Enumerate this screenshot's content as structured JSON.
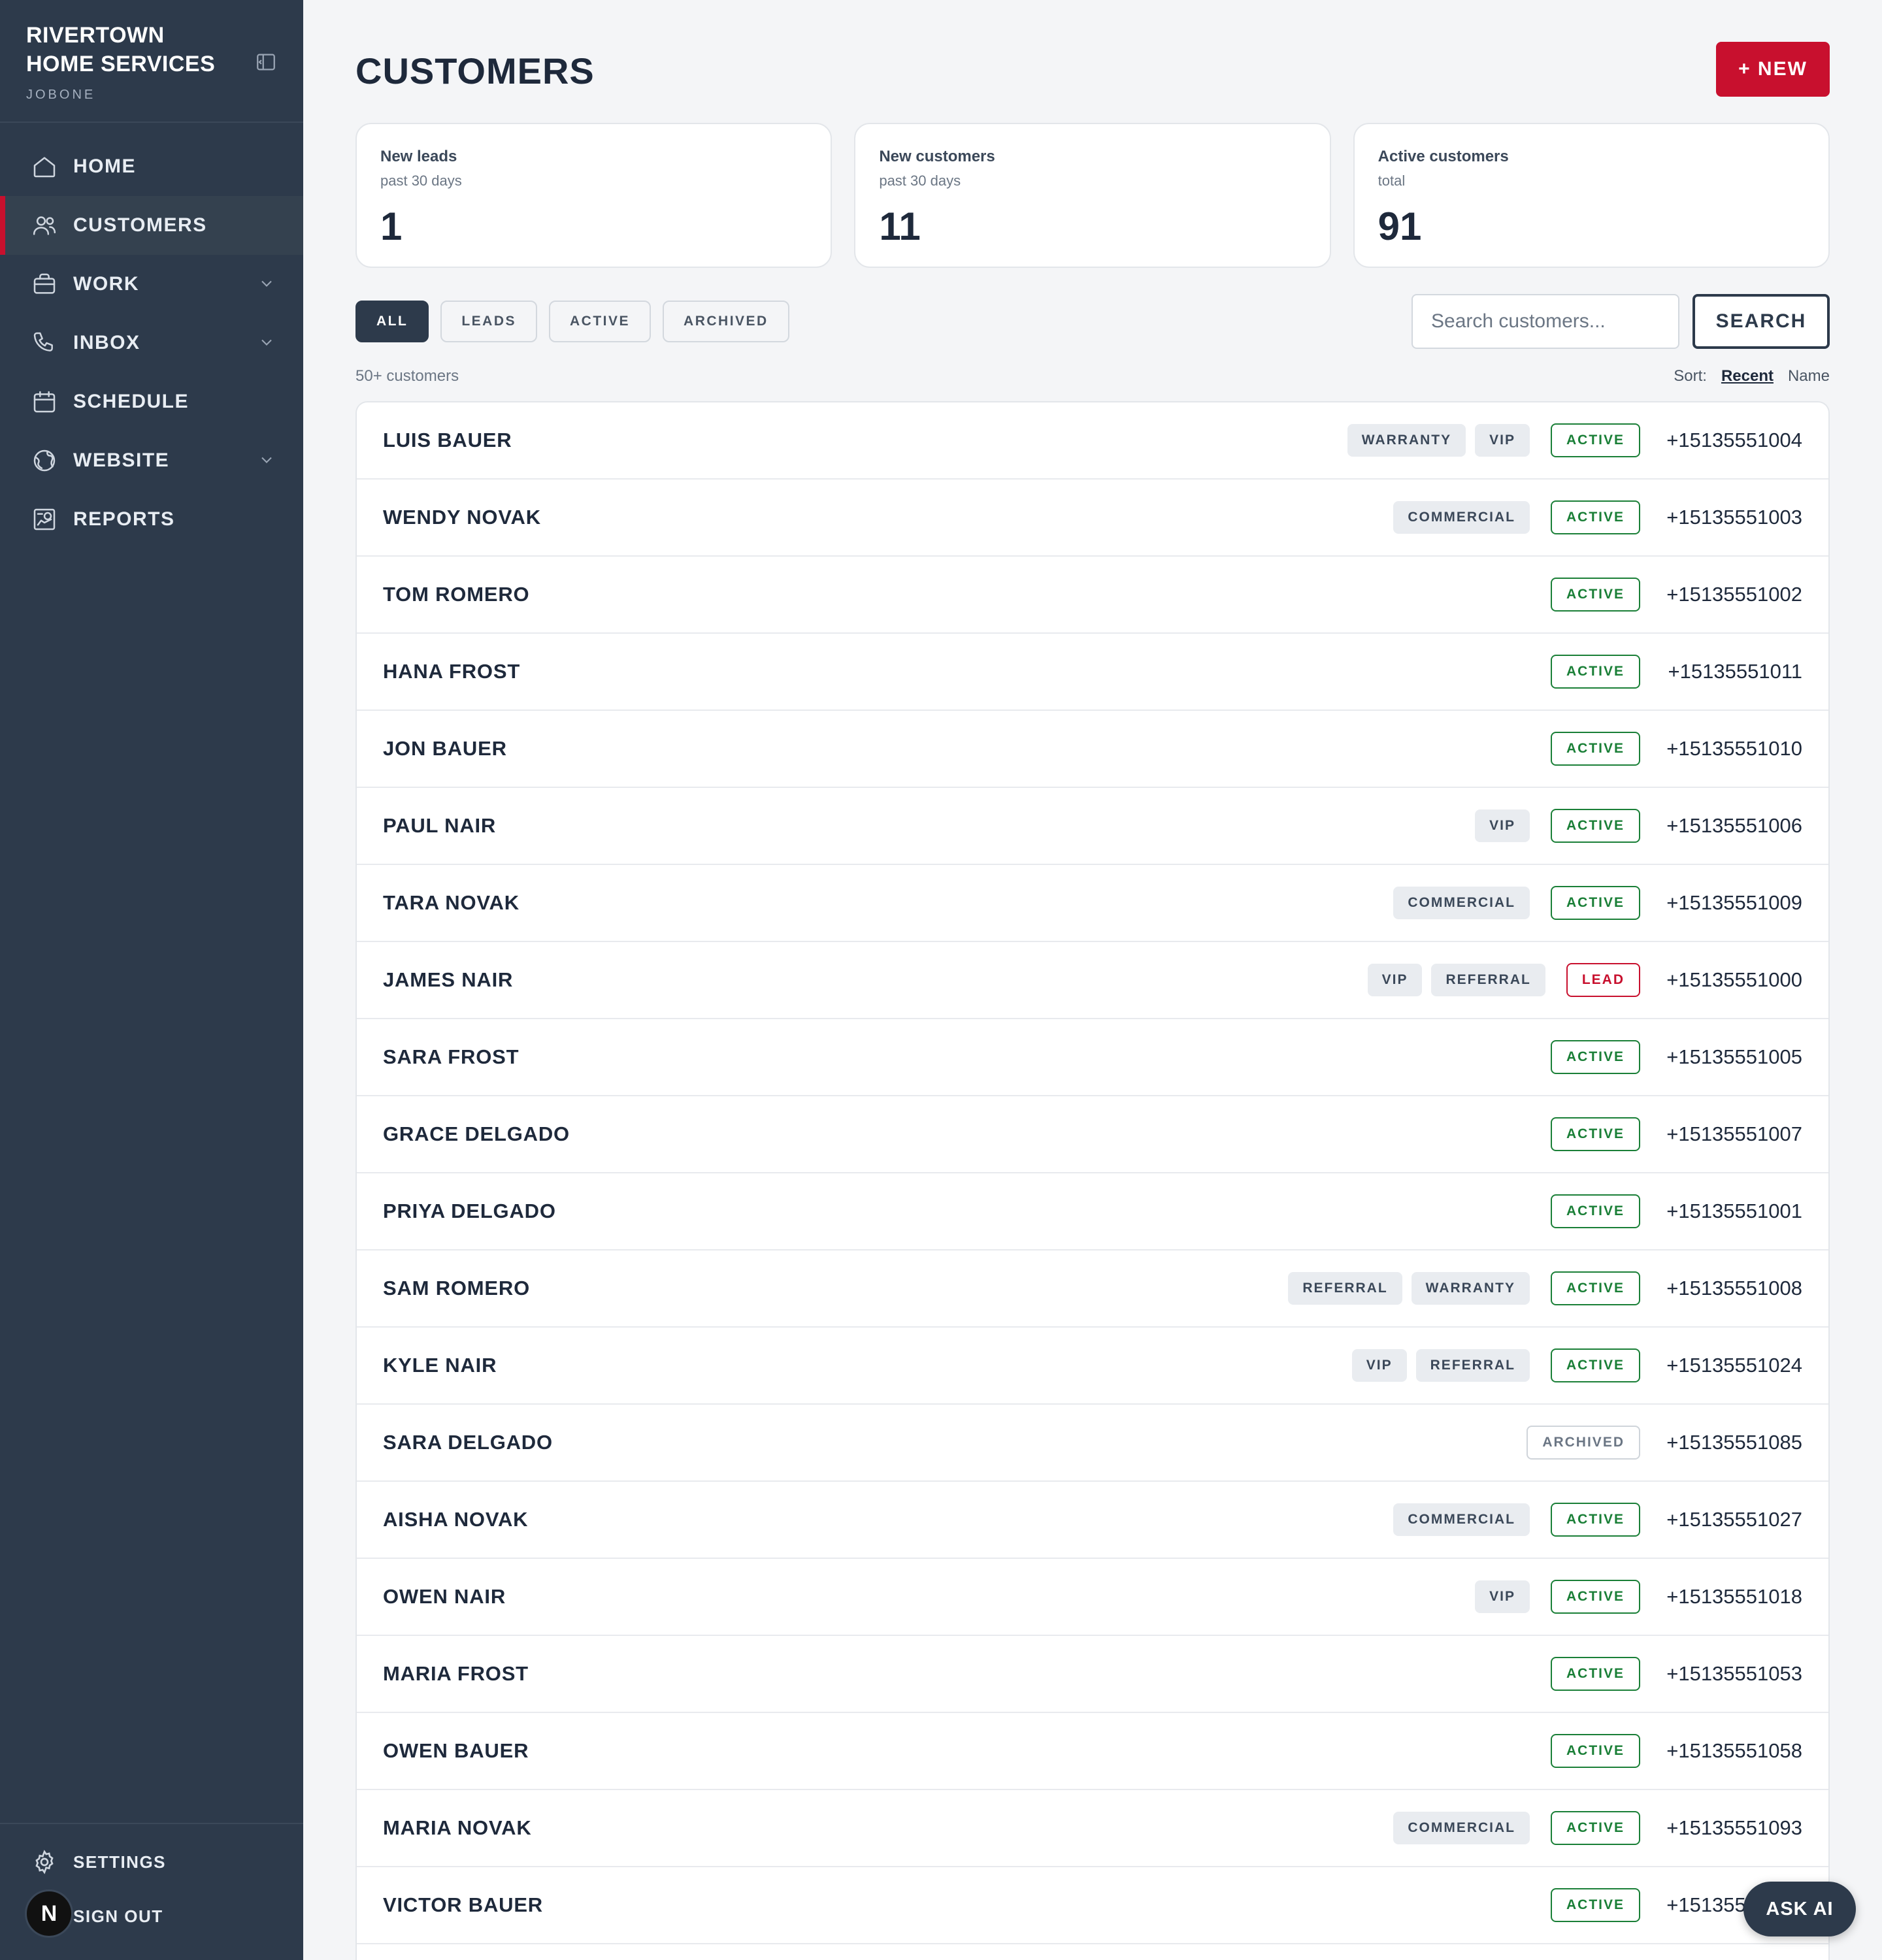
{
  "brand": {
    "title": "RIVERTOWN HOME SERVICES",
    "subtitle": "JOBONE"
  },
  "nav": [
    {
      "label": "HOME",
      "icon": "home-icon",
      "active": false,
      "expandable": false
    },
    {
      "label": "CUSTOMERS",
      "icon": "users-icon",
      "active": true,
      "expandable": false
    },
    {
      "label": "WORK",
      "icon": "briefcase-icon",
      "active": false,
      "expandable": true
    },
    {
      "label": "INBOX",
      "icon": "phone-icon",
      "active": false,
      "expandable": true
    },
    {
      "label": "SCHEDULE",
      "icon": "calendar-icon",
      "active": false,
      "expandable": false
    },
    {
      "label": "WEBSITE",
      "icon": "globe-icon",
      "active": false,
      "expandable": true
    },
    {
      "label": "REPORTS",
      "icon": "report-icon",
      "active": false,
      "expandable": false
    }
  ],
  "sidebar_bottom": {
    "settings": "SETTINGS",
    "signout": "SIGN OUT",
    "avatar_letter": "N"
  },
  "page": {
    "title": "CUSTOMERS",
    "new_button": "+ NEW"
  },
  "stats": [
    {
      "label": "New leads",
      "sub": "past 30 days",
      "value": "1"
    },
    {
      "label": "New customers",
      "sub": "past 30 days",
      "value": "11"
    },
    {
      "label": "Active customers",
      "sub": "total",
      "value": "91"
    }
  ],
  "filters": [
    "ALL",
    "LEADS",
    "ACTIVE",
    "ARCHIVED"
  ],
  "active_filter": "ALL",
  "search": {
    "placeholder": "Search customers...",
    "button": "SEARCH"
  },
  "count_text": "50+ customers",
  "sort": {
    "label": "Sort:",
    "options": [
      "Recent",
      "Name"
    ],
    "current": "Recent"
  },
  "customers": [
    {
      "name": "LUIS BAUER",
      "tags": [
        "WARRANTY",
        "VIP"
      ],
      "status": "ACTIVE",
      "phone": "+15135551004"
    },
    {
      "name": "WENDY NOVAK",
      "tags": [
        "COMMERCIAL"
      ],
      "status": "ACTIVE",
      "phone": "+15135551003"
    },
    {
      "name": "TOM ROMERO",
      "tags": [],
      "status": "ACTIVE",
      "phone": "+15135551002"
    },
    {
      "name": "HANA FROST",
      "tags": [],
      "status": "ACTIVE",
      "phone": "+15135551011"
    },
    {
      "name": "JON BAUER",
      "tags": [],
      "status": "ACTIVE",
      "phone": "+15135551010"
    },
    {
      "name": "PAUL NAIR",
      "tags": [
        "VIP"
      ],
      "status": "ACTIVE",
      "phone": "+15135551006"
    },
    {
      "name": "TARA NOVAK",
      "tags": [
        "COMMERCIAL"
      ],
      "status": "ACTIVE",
      "phone": "+15135551009"
    },
    {
      "name": "JAMES NAIR",
      "tags": [
        "VIP",
        "REFERRAL"
      ],
      "status": "LEAD",
      "phone": "+15135551000"
    },
    {
      "name": "SARA FROST",
      "tags": [],
      "status": "ACTIVE",
      "phone": "+15135551005"
    },
    {
      "name": "GRACE DELGADO",
      "tags": [],
      "status": "ACTIVE",
      "phone": "+15135551007"
    },
    {
      "name": "PRIYA DELGADO",
      "tags": [],
      "status": "ACTIVE",
      "phone": "+15135551001"
    },
    {
      "name": "SAM ROMERO",
      "tags": [
        "REFERRAL",
        "WARRANTY"
      ],
      "status": "ACTIVE",
      "phone": "+15135551008"
    },
    {
      "name": "KYLE NAIR",
      "tags": [
        "VIP",
        "REFERRAL"
      ],
      "status": "ACTIVE",
      "phone": "+15135551024"
    },
    {
      "name": "SARA DELGADO",
      "tags": [],
      "status": "ARCHIVED",
      "phone": "+15135551085"
    },
    {
      "name": "AISHA NOVAK",
      "tags": [
        "COMMERCIAL"
      ],
      "status": "ACTIVE",
      "phone": "+15135551027"
    },
    {
      "name": "OWEN NAIR",
      "tags": [
        "VIP"
      ],
      "status": "ACTIVE",
      "phone": "+15135551018"
    },
    {
      "name": "MARIA FROST",
      "tags": [],
      "status": "ACTIVE",
      "phone": "+15135551053"
    },
    {
      "name": "OWEN BAUER",
      "tags": [],
      "status": "ACTIVE",
      "phone": "+15135551058"
    },
    {
      "name": "MARIA NOVAK",
      "tags": [
        "COMMERCIAL"
      ],
      "status": "ACTIVE",
      "phone": "+15135551093"
    },
    {
      "name": "VICTOR BAUER",
      "tags": [],
      "status": "ACTIVE",
      "phone": "+15135551075"
    }
  ],
  "ask_ai": "ASK AI",
  "colors": {
    "sidebar": "#2d3a4b",
    "accent": "#c8102e",
    "active_green": "#1a7f37"
  }
}
